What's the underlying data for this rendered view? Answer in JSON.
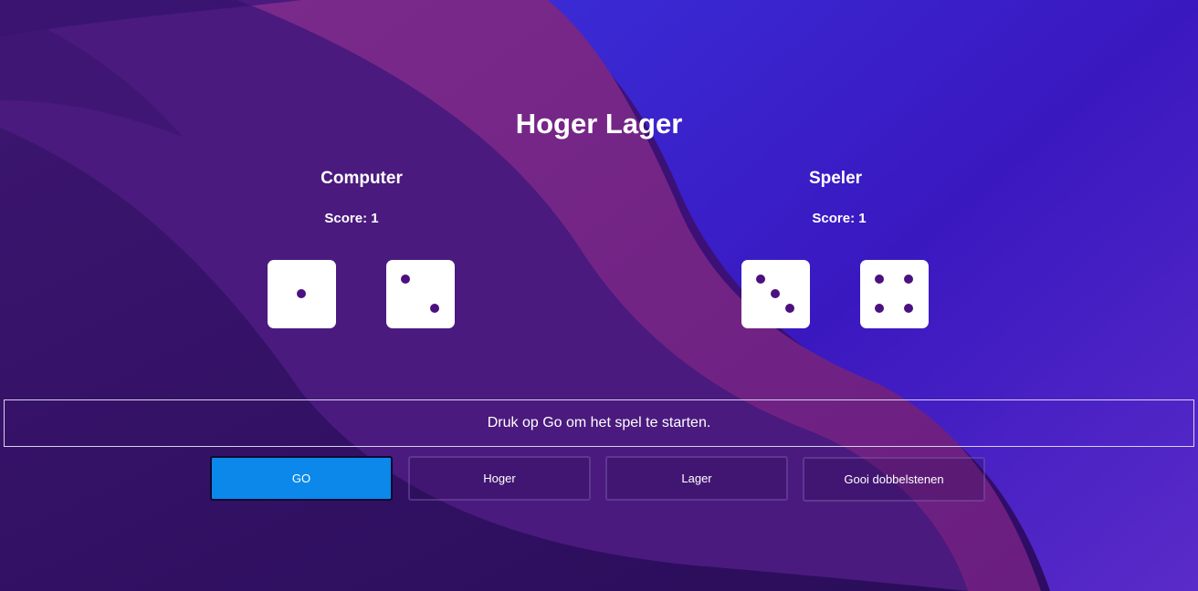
{
  "title": "Hoger Lager",
  "computer": {
    "name": "Computer",
    "score_label": "Score: 1",
    "dice": [
      1,
      2
    ]
  },
  "player": {
    "name": "Speler",
    "score_label": "Score: 1",
    "dice": [
      3,
      4
    ]
  },
  "message": "Druk op Go om het spel te starten.",
  "buttons": {
    "go": "GO",
    "higher": "Hoger",
    "lower": "Lager",
    "roll": "Gooi dobbelstenen"
  },
  "colors": {
    "go_button": "#0b88ea",
    "pip": "#4b1180",
    "die_face": "#ffffff"
  }
}
